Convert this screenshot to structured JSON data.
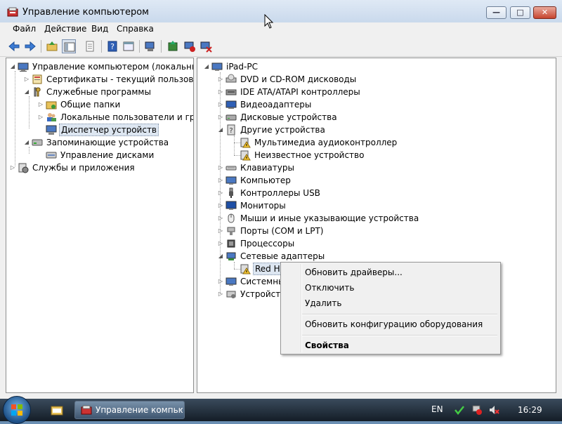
{
  "window": {
    "title": "Управление компьютером",
    "minimize_glyph": "—",
    "maximize_glyph": "□",
    "close_glyph": "✕"
  },
  "menu": [
    "Файл",
    "Действие",
    "Вид",
    "Справка"
  ],
  "toolbar_icons": [
    "back-arrow-icon",
    "forward-arrow-icon",
    "up-folder-icon",
    "show-hide-tree-icon",
    "properties-sheet-icon",
    "help-icon",
    "console-view-icon",
    "scan-hardware-icon",
    "update-driver-icon",
    "disable-device-icon",
    "uninstall-device-icon"
  ],
  "left_tree": [
    {
      "label": "Управление компьютером (локальным)",
      "icon": "computer-management-icon"
    },
    {
      "label": "Сертификаты - текущий пользователь",
      "icon": "certificates-icon"
    },
    {
      "label": "Служебные программы",
      "icon": "system-tools-icon"
    },
    {
      "label": "Общие папки",
      "icon": "shared-folders-icon"
    },
    {
      "label": "Локальные пользователи и группы",
      "icon": "local-users-icon"
    },
    {
      "label": "Диспетчер устройств",
      "icon": "device-manager-icon"
    },
    {
      "label": "Запоминающие устройства",
      "icon": "storage-icon"
    },
    {
      "label": "Управление дисками",
      "icon": "disk-management-icon"
    },
    {
      "label": "Службы и приложения",
      "icon": "services-apps-icon"
    }
  ],
  "right_tree": [
    {
      "label": "iPad-PC",
      "icon": "computer-icon"
    },
    {
      "label": "DVD и CD-ROM дисководы",
      "icon": "dvd-drive-icon"
    },
    {
      "label": "IDE ATA/ATAPI контроллеры",
      "icon": "ide-controller-icon"
    },
    {
      "label": "Видеоадаптеры",
      "icon": "display-adapter-icon"
    },
    {
      "label": "Дисковые устройства",
      "icon": "disk-drive-icon"
    },
    {
      "label": "Другие устройства",
      "icon": "other-devices-icon"
    },
    {
      "label": "Мультимедиа аудиоконтроллер",
      "icon": "warning-device-icon"
    },
    {
      "label": "Неизвестное устройство",
      "icon": "warning-device-icon"
    },
    {
      "label": "Клавиатуры",
      "icon": "keyboard-icon"
    },
    {
      "label": "Компьютер",
      "icon": "computer-icon"
    },
    {
      "label": "Контроллеры USB",
      "icon": "usb-icon"
    },
    {
      "label": "Мониторы",
      "icon": "monitor-icon"
    },
    {
      "label": "Мыши и иные указывающие устройства",
      "icon": "mouse-icon"
    },
    {
      "label": "Порты (COM и LPT)",
      "icon": "port-icon"
    },
    {
      "label": "Процессоры",
      "icon": "processor-icon"
    },
    {
      "label": "Сетевые адаптеры",
      "icon": "network-adapter-icon"
    },
    {
      "label": "Red Ha",
      "icon": "warning-device-icon"
    },
    {
      "label": "Системны",
      "icon": "system-devices-icon"
    },
    {
      "label": "Устройств",
      "icon": "hid-icon"
    }
  ],
  "context_menu": {
    "update_driver": "Обновить драйверы...",
    "disable": "Отключить",
    "uninstall": "Удалить",
    "scan": "Обновить конфигурацию оборудования",
    "properties": "Свойства"
  },
  "taskbar": {
    "task_label": "Управление компью...",
    "language": "EN",
    "clock": "16:29"
  }
}
